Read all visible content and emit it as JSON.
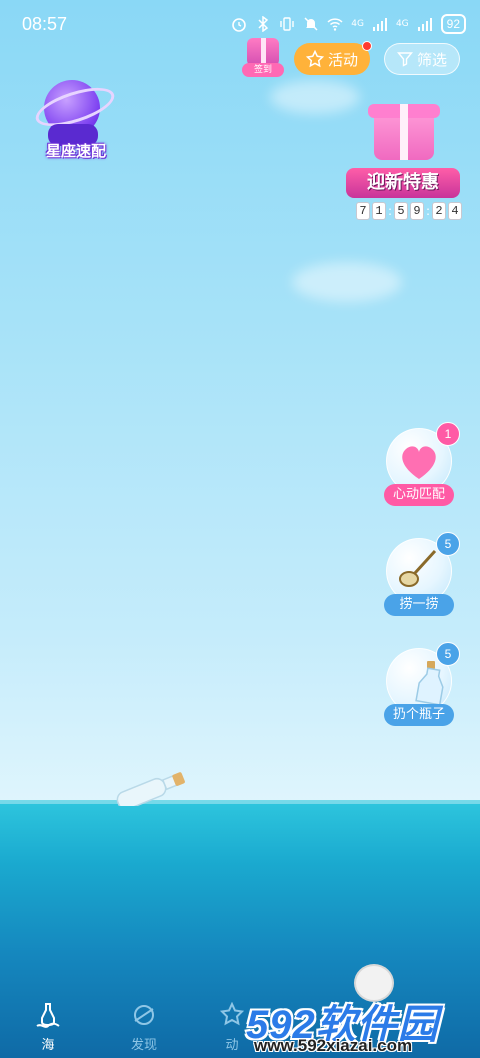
{
  "status_bar": {
    "time": "08:57",
    "battery": "92",
    "net1": "4G",
    "net2": "4G",
    "icons": [
      "alarm-icon",
      "bluetooth-icon",
      "vibrate-icon",
      "mute-icon",
      "wifi-icon",
      "signal-icon",
      "signal-icon",
      "battery-icon"
    ]
  },
  "header": {
    "signin_label": "签到",
    "activity_label": "活动",
    "filter_label": "筛选"
  },
  "constellation": {
    "label": "星座速配"
  },
  "promo": {
    "title": "迎新特惠",
    "countdown": [
      "7",
      "1",
      ":",
      "5",
      "9",
      ":",
      "2",
      "4"
    ]
  },
  "side_actions": [
    {
      "label": "心动匹配",
      "badge": "1",
      "badge_color": "#ff5aa5",
      "label_color": "#ff5aa5",
      "icon": "heart-icon"
    },
    {
      "label": "捞一捞",
      "badge": "5",
      "badge_color": "#4aa3e8",
      "label_color": "#4aa3e8",
      "icon": "net-icon"
    },
    {
      "label": "扔个瓶子",
      "badge": "5",
      "badge_color": "#4aa3e8",
      "label_color": "#4aa3e8",
      "icon": "bottle-icon"
    }
  ],
  "tabs": [
    {
      "label": "海",
      "active": true,
      "icon": "sea-bottle-icon"
    },
    {
      "label": "发现",
      "active": false,
      "icon": "planet-icon"
    },
    {
      "label": "动",
      "active": false,
      "icon": "star-icon"
    }
  ],
  "watermark": {
    "main": "592软件园",
    "url": "www.592xiazai.com"
  },
  "colors": {
    "sky_top": "#8ad8f6",
    "sea": "#1aa9cf",
    "activity": "#ffb23a",
    "pink_accent": "#ff5aa5",
    "blue_accent": "#4aa3e8"
  }
}
